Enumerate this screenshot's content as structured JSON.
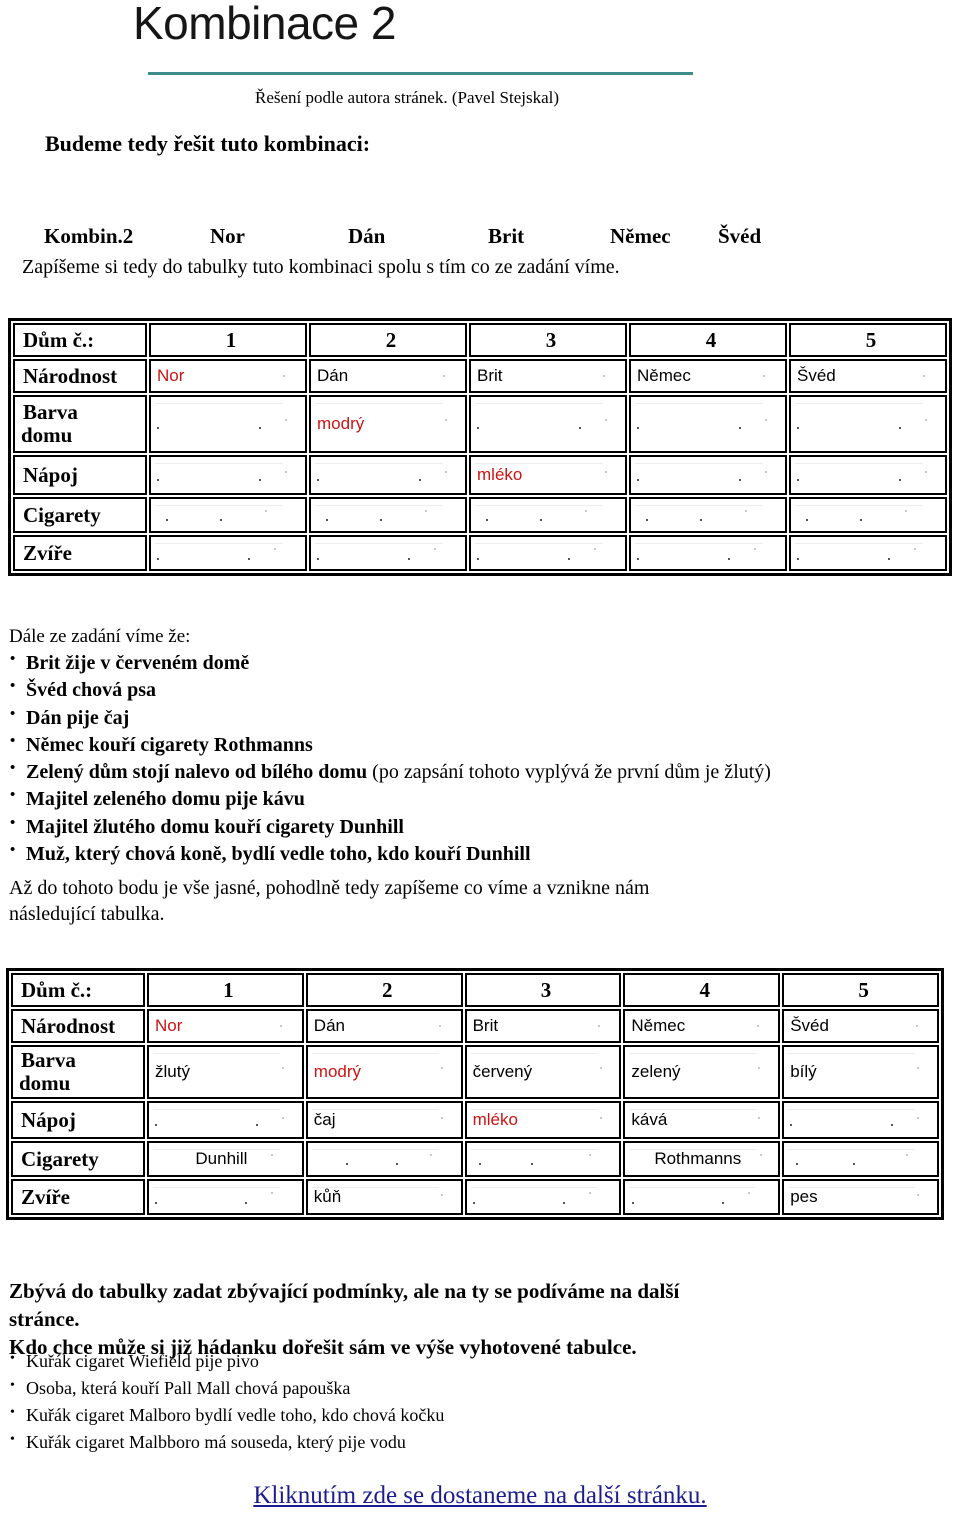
{
  "header": {
    "title": "Kombinace 2",
    "subtitle": "Řešení podle autora stránek. (Pavel Stejskal)",
    "lead": "Budeme tedy řešit tuto kombinaci:",
    "rule_color": "#3d8b8b"
  },
  "combination": {
    "label": "Kombin.2",
    "items": [
      "Nor",
      "Dán",
      "Brit",
      "Němec",
      "Švéd"
    ],
    "note": "Zapíšeme si tedy do tabulky tuto kombinaci spolu s tím co ze zadání víme."
  },
  "colors": {
    "highlight_red": "#cc1414",
    "link_blue": "#1c1c8e",
    "rule_teal": "#3d8b8b"
  },
  "table_1": {
    "row_labels": [
      "Dům č.:",
      "Národnost",
      "Barva\ndomu",
      "Nápoj",
      "Cigarety",
      "Zvíře"
    ],
    "house_numbers": [
      "1",
      "2",
      "3",
      "4",
      "5"
    ],
    "rows": [
      {
        "label": "Národnost",
        "cells": [
          {
            "text": "Nor",
            "red": true
          },
          {
            "text": "Dán",
            "red": false
          },
          {
            "text": "Brit",
            "red": false
          },
          {
            "text": "Němec",
            "red": false
          },
          {
            "text": "Švéd",
            "red": false
          }
        ]
      },
      {
        "label": "Barva domu",
        "cells": [
          {
            "text": "",
            "red": false
          },
          {
            "text": "modrý",
            "red": true
          },
          {
            "text": "",
            "red": false
          },
          {
            "text": "",
            "red": false
          },
          {
            "text": "",
            "red": false
          }
        ]
      },
      {
        "label": "Nápoj",
        "cells": [
          {
            "text": "",
            "red": false
          },
          {
            "text": "",
            "red": false
          },
          {
            "text": "mléko",
            "red": true
          },
          {
            "text": "",
            "red": false
          },
          {
            "text": "",
            "red": false
          }
        ]
      },
      {
        "label": "Cigarety",
        "cells": [
          {
            "text": "",
            "red": false
          },
          {
            "text": "",
            "red": false
          },
          {
            "text": "",
            "red": false
          },
          {
            "text": "",
            "red": false
          },
          {
            "text": "",
            "red": false
          }
        ]
      },
      {
        "label": "Zvíře",
        "cells": [
          {
            "text": "",
            "red": false
          },
          {
            "text": "",
            "red": false
          },
          {
            "text": "",
            "red": false
          },
          {
            "text": "",
            "red": false
          },
          {
            "text": "",
            "red": false
          }
        ]
      }
    ]
  },
  "clues": {
    "intro": "Dále ze zadání víme že:",
    "items": [
      {
        "bold": "Brit žije v červeném domě",
        "soft": ""
      },
      {
        "bold": "Švéd chová psa",
        "soft": ""
      },
      {
        "bold": "Dán pije čaj",
        "soft": ""
      },
      {
        "bold": "Němec kouří cigarety Rothmanns",
        "soft": ""
      },
      {
        "bold": "Zelený dům stojí nalevo od bílého domu",
        "soft": " (po zapsání tohoto vyplývá že první dům je žlutý)"
      },
      {
        "bold": "Majitel zeleného domu pije kávu",
        "soft": ""
      },
      {
        "bold": "Majitel žlutého domu kouří cigarety Dunhill",
        "soft": ""
      },
      {
        "bold": "Muž, který chová koně, bydlí vedle toho, kdo kouří Dunhill",
        "soft": ""
      }
    ],
    "tail": "Až  do tohoto bodu je vše jasné, pohodlně tedy zapíšeme co víme a vznikne nám následující tabulka."
  },
  "table_2": {
    "row_labels": [
      "Dům č.:",
      "Národnost",
      "Barva\ndomu",
      "Nápoj",
      "Cigarety",
      "Zvíře"
    ],
    "house_numbers": [
      "1",
      "2",
      "3",
      "4",
      "5"
    ],
    "rows": [
      {
        "label": "Národnost",
        "cells": [
          {
            "text": "Nor",
            "red": true
          },
          {
            "text": "Dán",
            "red": false
          },
          {
            "text": "Brit",
            "red": false
          },
          {
            "text": "Němec",
            "red": false
          },
          {
            "text": "Švéd",
            "red": false
          }
        ]
      },
      {
        "label": "Barva domu",
        "cells": [
          {
            "text": "žlutý",
            "red": false
          },
          {
            "text": "modrý",
            "red": true
          },
          {
            "text": "červený",
            "red": false
          },
          {
            "text": "zelený",
            "red": false
          },
          {
            "text": "bílý",
            "red": false
          }
        ]
      },
      {
        "label": "Nápoj",
        "cells": [
          {
            "text": "",
            "red": false
          },
          {
            "text": "čaj",
            "red": false
          },
          {
            "text": "mléko",
            "red": true
          },
          {
            "text": "kává",
            "red": false
          },
          {
            "text": "",
            "red": false
          }
        ]
      },
      {
        "label": "Cigarety",
        "cells": [
          {
            "text": "Dunhill",
            "red": false,
            "center": true
          },
          {
            "text": "",
            "red": false
          },
          {
            "text": "",
            "red": false
          },
          {
            "text": "Rothmanns",
            "red": false,
            "center": true
          },
          {
            "text": "",
            "red": false
          }
        ]
      },
      {
        "label": "Zvíře",
        "cells": [
          {
            "text": "",
            "red": false
          },
          {
            "text": "kůň",
            "red": false
          },
          {
            "text": "",
            "red": false
          },
          {
            "text": "",
            "red": false
          },
          {
            "text": "pes",
            "red": false
          }
        ]
      }
    ]
  },
  "footer": {
    "heading": "Zbývá do tabulky zadat zbývající podmínky, ale na ty se podíváme na další stránce.\nKdo chce může si již hádanku dořešit sám ve výše vyhotovené tabulce.",
    "remaining_clues": [
      "Kuřák cigaret Wiefield pije pivo",
      "Osoba, která kouří Pall Mall chová papouška",
      "Kuřák cigaret Malboro bydlí vedle toho, kdo chová kočku",
      "Kuřák cigaret Malbboro má souseda, který pije vodu"
    ],
    "link_text": "Kliknutím zde se dostaneme na další stránku."
  }
}
